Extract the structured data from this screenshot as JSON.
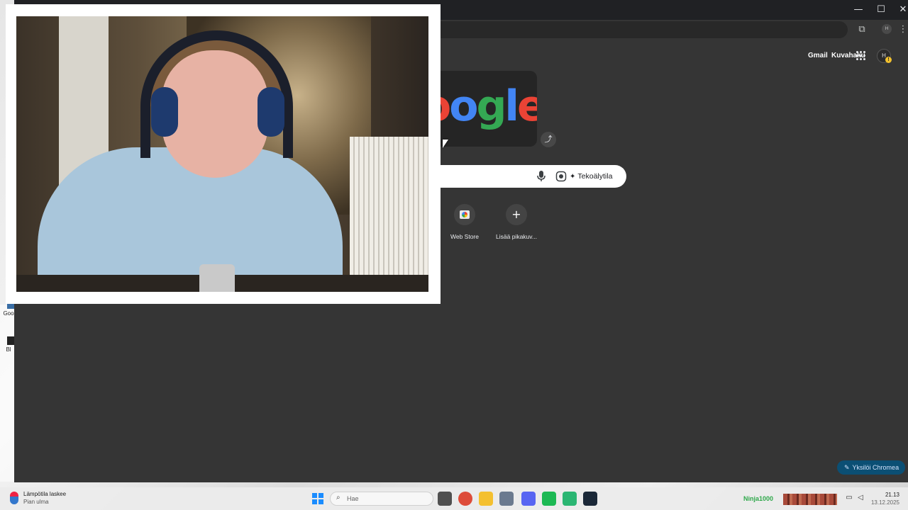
{
  "desktop": {
    "icons": [
      {
        "label": "Goo",
        "icon": "app-icon"
      },
      {
        "label": "Bl",
        "icon": "app-icon"
      }
    ]
  },
  "window_controls": {
    "minimize": "—",
    "maximize": "☐",
    "close": "✕"
  },
  "toolbar": {
    "extensions_icon": "puzzle-icon",
    "profile_initial": "H",
    "menu_icon": "kebab-menu-icon"
  },
  "header_links": {
    "gmail": "Gmail",
    "images": "Kuvahaku",
    "avatar_initial": "H",
    "avatar_badge": "!"
  },
  "doodle": {
    "text": "oogle",
    "colors": [
      "#ea4335",
      "#4285f4",
      "#34a853",
      "#fbbc05",
      "#ea4335"
    ]
  },
  "search": {
    "ai_mode_label": "Tekoälytila",
    "mic_icon": "microphone-icon",
    "lens_icon": "google-lens-icon"
  },
  "shortcuts": [
    {
      "label": "Web Store",
      "icon": "chrome-web-store-icon"
    },
    {
      "label": "Lisää pikakuv...",
      "icon": "plus-icon"
    }
  ],
  "customize": {
    "label": "Yksilöi Chromea"
  },
  "taskbar": {
    "weather_title": "Lämpötila laskee",
    "weather_subtitle": "Pian ulma",
    "search_placeholder": "Hae",
    "apps": [
      {
        "name": "task-view",
        "color": "#505050"
      },
      {
        "name": "chrome",
        "color": "#dd4b39"
      },
      {
        "name": "file-explorer",
        "color": "#f4c030"
      },
      {
        "name": "settings",
        "color": "#6b7a8f"
      },
      {
        "name": "discord",
        "color": "#5865f2"
      },
      {
        "name": "spotify",
        "color": "#1db954"
      },
      {
        "name": "app-green",
        "color": "#2bb673"
      },
      {
        "name": "steam",
        "color": "#1b2838"
      }
    ],
    "tray_username": "Ninja1000",
    "time": "21.13",
    "date": "13.12.2025"
  },
  "colors": {
    "chrome_bg": "#353535",
    "accent_blue": "#0b4f74"
  }
}
